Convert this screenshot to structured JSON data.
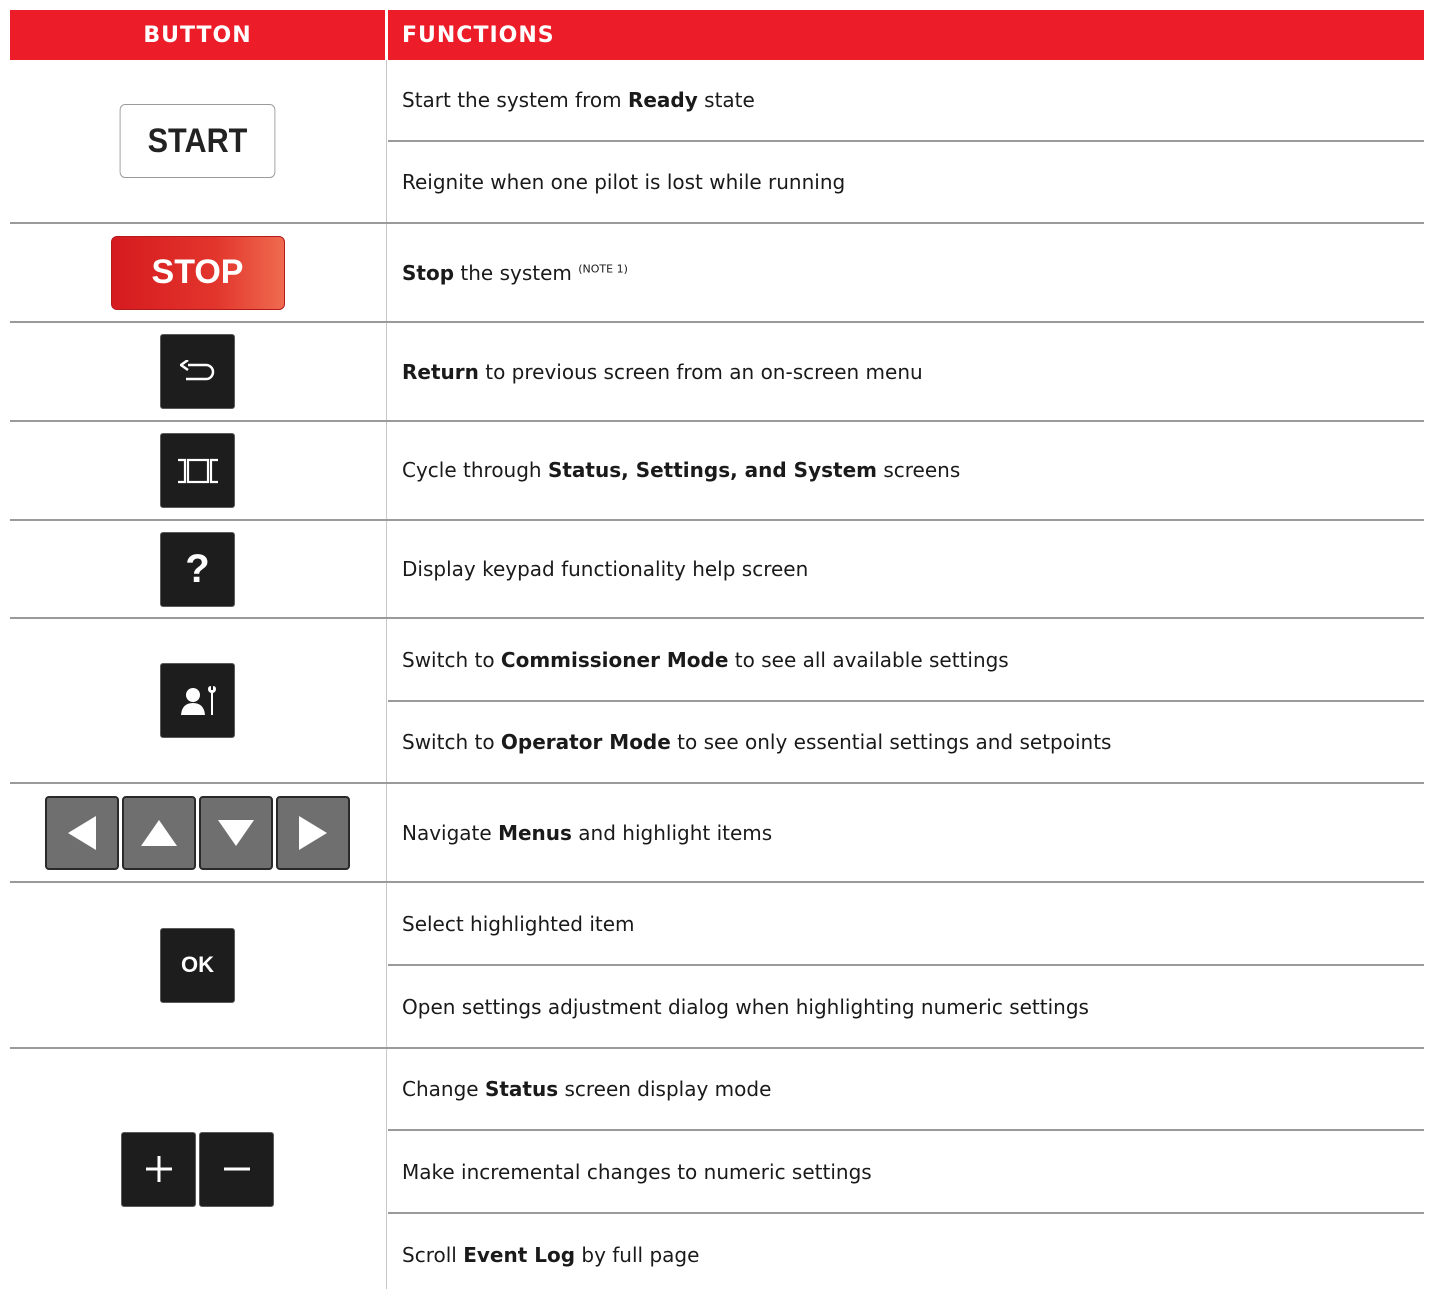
{
  "header": {
    "button_col": "BUTTON",
    "functions_col": "FUNCTIONS"
  },
  "buttons": {
    "start_label": "START",
    "stop_label": "STOP",
    "help_label": "?",
    "ok_label": "OK"
  },
  "icons": {
    "return": "return-arrow-icon",
    "cycle_screens": "screen-cycle-icon",
    "help": "question-mark",
    "mode": "person-wrench-icon",
    "arrows": [
      "left-arrow-icon",
      "up-arrow-icon",
      "down-arrow-icon",
      "right-arrow-icon"
    ],
    "plus_minus": [
      "plus-icon",
      "minus-icon"
    ]
  },
  "functions": {
    "start_1": {
      "pre": "Start the system from ",
      "bold": "Ready",
      "post": " state"
    },
    "start_2": {
      "text": "Reignite when one pilot is lost while running"
    },
    "stop_1": {
      "bold": "Stop",
      "post": " the system ",
      "note": "(NOTE 1)"
    },
    "return_1": {
      "bold": "Return",
      "post": " to previous screen from an on-screen menu"
    },
    "cycle_1": {
      "pre": "Cycle through ",
      "bold": "Status, Settings, and System",
      "post": " screens"
    },
    "help_1": {
      "text": "Display keypad functionality help screen"
    },
    "mode_1": {
      "pre": "Switch to ",
      "bold": "Commissioner Mode",
      "post": " to see all available settings"
    },
    "mode_2": {
      "pre": "Switch to ",
      "bold": "Operator Mode",
      "post": " to see only essential settings and setpoints"
    },
    "nav_1": {
      "pre": "Navigate ",
      "bold": "Menus",
      "post": " and highlight items"
    },
    "ok_1": {
      "text": "Select highlighted item"
    },
    "ok_2": {
      "text": "Open settings adjustment dialog when highlighting numeric settings"
    },
    "pm_1": {
      "pre": "Change ",
      "bold": "Status",
      "post": " screen display mode"
    },
    "pm_2": {
      "text": "Make incremental changes to numeric settings"
    },
    "pm_3": {
      "pre": "Scroll ",
      "bold": "Event Log",
      "post": " by full page"
    }
  },
  "colors": {
    "header_bg": "#ed1c29",
    "stop_button": "#d61a1f",
    "dark_button": "#1d1d1d",
    "arrow_button": "#6f6f6f"
  }
}
